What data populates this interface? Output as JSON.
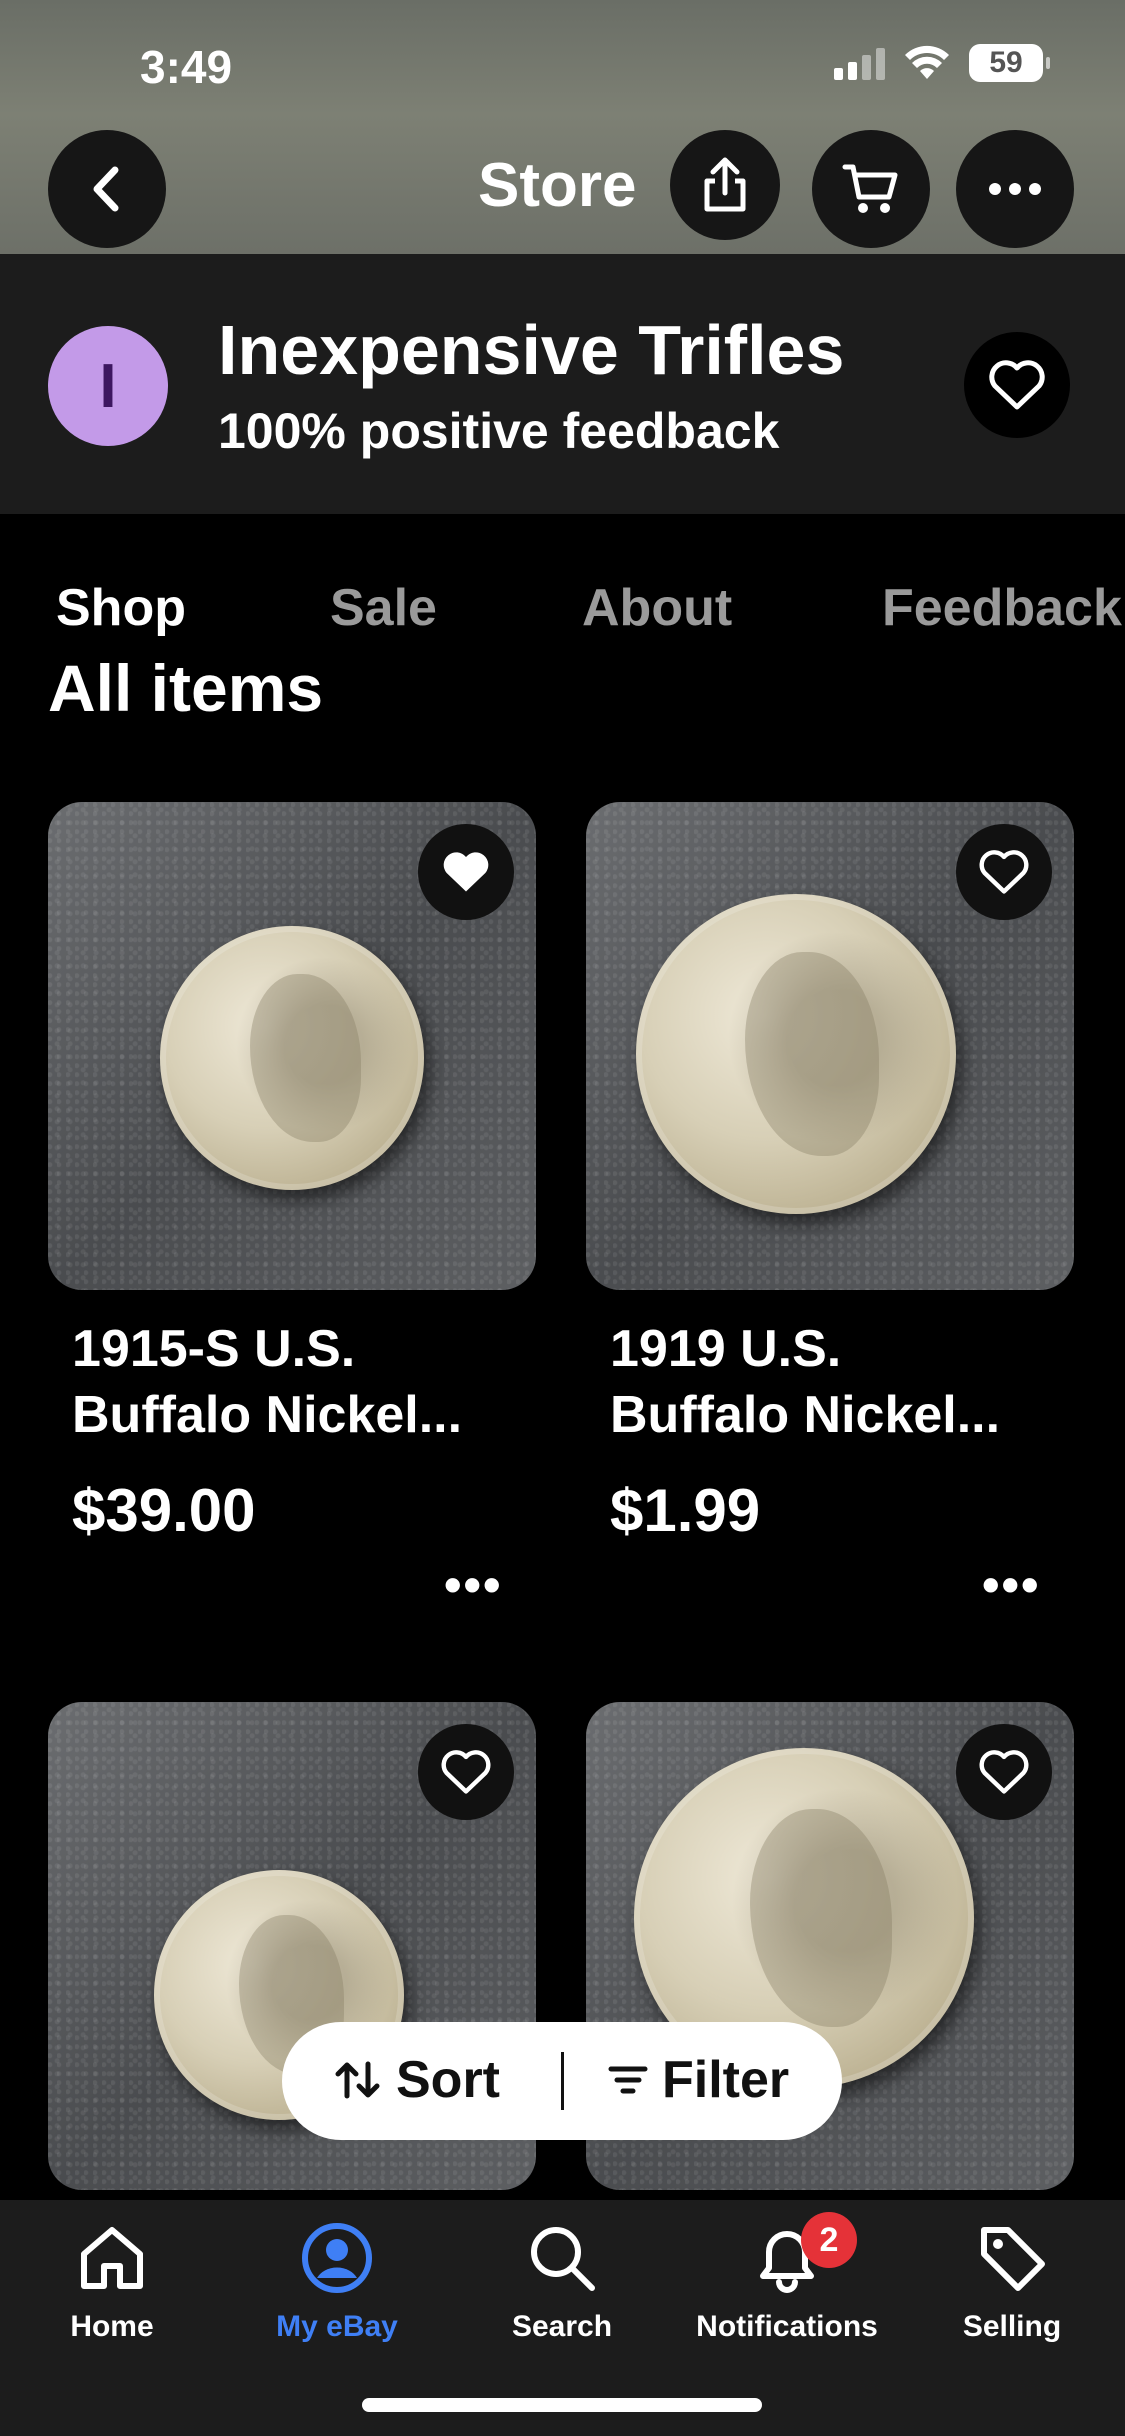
{
  "status_bar": {
    "time": "3:49",
    "battery": "59"
  },
  "header": {
    "title": "Store"
  },
  "seller": {
    "avatar_letter": "I",
    "name": "Inexpensive Trifles",
    "feedback": "100% positive feedback"
  },
  "tabs": [
    {
      "label": "Shop",
      "active": true
    },
    {
      "label": "Sale",
      "active": false
    },
    {
      "label": "About",
      "active": false
    },
    {
      "label": "Feedback",
      "active": false
    }
  ],
  "section_title": "All items",
  "products": [
    {
      "title_line1": "1915-S  U.S.",
      "title_line2": "Buffalo Nickel...",
      "price": "$39.00",
      "favorited": true
    },
    {
      "title_line1": "1919  U.S.",
      "title_line2": "Buffalo Nickel...",
      "price": "$1.99",
      "favorited": false
    },
    {
      "title_line1": "",
      "title_line2": "",
      "price": "",
      "favorited": false
    },
    {
      "title_line1": "",
      "title_line2": "",
      "price": "",
      "favorited": false
    }
  ],
  "more_glyph": "•••",
  "sort_filter": {
    "sort_label": "Sort",
    "filter_label": "Filter"
  },
  "bottom_nav": [
    {
      "label": "Home",
      "icon": "home-icon"
    },
    {
      "label": "My eBay",
      "icon": "account-icon",
      "active": true
    },
    {
      "label": "Search",
      "icon": "search-icon"
    },
    {
      "label": "Notifications",
      "icon": "bell-icon",
      "badge": "2"
    },
    {
      "label": "Selling",
      "icon": "tag-icon"
    }
  ],
  "colors": {
    "accent": "#3f7ff5",
    "badge": "#e53238",
    "avatar": "#c39ae8"
  }
}
